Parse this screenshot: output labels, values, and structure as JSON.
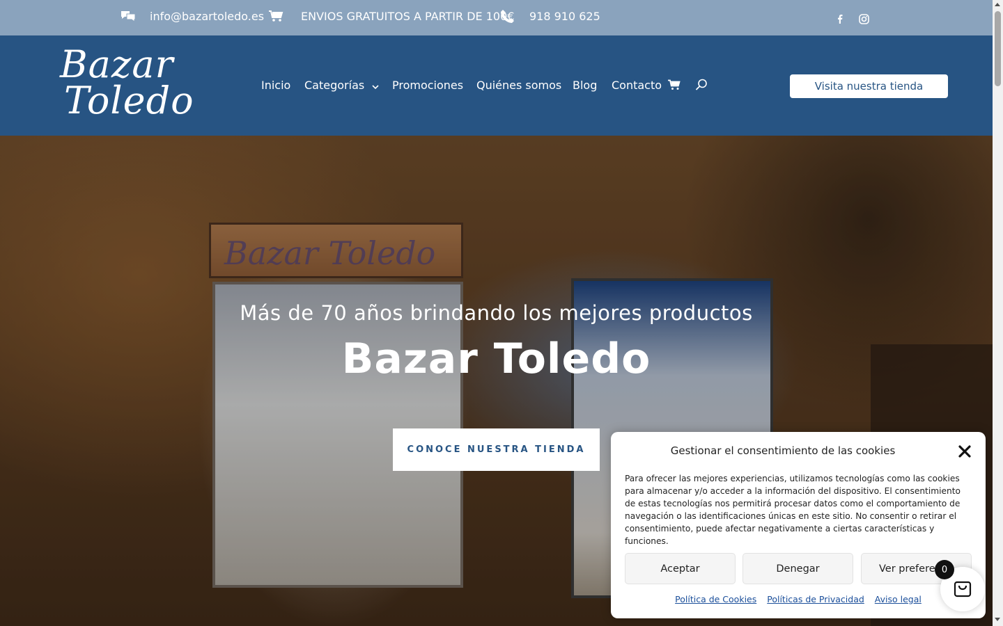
{
  "topbar": {
    "email": "info@bazartoledo.es",
    "shipping": "ENVIOS GRATUITOS A PARTIR DE 100€",
    "phone": "918 910 625",
    "icons": [
      "chat-icon",
      "cart-icon",
      "phone-icon",
      "facebook-icon",
      "instagram-icon"
    ]
  },
  "header": {
    "logo_line1": "Bazar",
    "logo_line2": "Toledo",
    "nav": {
      "inicio": "Inicio",
      "categorias": "Categorías",
      "promociones": "Promociones",
      "quienes": "Quiénes somos",
      "blog": "Blog",
      "contacto": "Contacto"
    },
    "cta": "Visita nuestra tienda"
  },
  "hero": {
    "subtitle": "Más de 70 años brindando los mejores productos",
    "title": "Bazar Toledo",
    "button": "CONOCE NUESTRA TIENDA",
    "photo_sign": "Bazar Toledo"
  },
  "cookie": {
    "title": "Gestionar el consentimiento de las cookies",
    "body": "Para ofrecer las mejores experiencias, utilizamos tecnologías como las cookies para almacenar y/o acceder a la información del dispositivo. El consentimiento de estas tecnologías nos permitirá procesar datos como el comportamiento de navegación o las identificaciones únicas en este sitio. No consentir o retirar el consentimiento, puede afectar negativamente a ciertas características y funciones.",
    "accept": "Aceptar",
    "deny": "Denegar",
    "preferences": "Ver preferen",
    "links": {
      "cookies": "Política de Cookies",
      "privacy": "Políticas de Privacidad",
      "legal": "Aviso legal"
    }
  },
  "cart": {
    "count": "0"
  },
  "colors": {
    "topbar": "#8aa3bd",
    "header": "#275483",
    "link": "#1a4e9a"
  }
}
